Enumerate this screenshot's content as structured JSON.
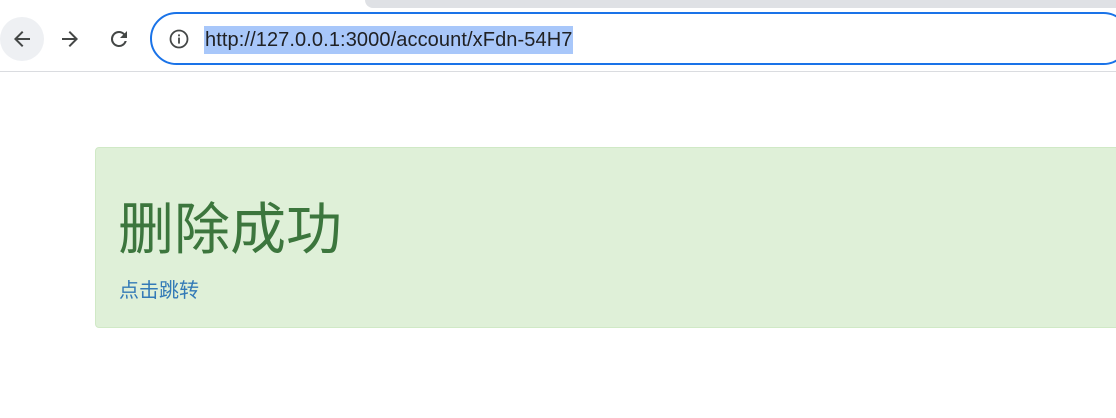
{
  "browser": {
    "nav": {
      "back_icon": "arrow-left-icon",
      "forward_icon": "arrow-right-icon",
      "reload_icon": "reload-icon"
    },
    "omnibox": {
      "site_info_icon": "info-circle-icon",
      "url": "http://127.0.0.1:3000/account/xFdn-54H7",
      "url_selected": true
    },
    "colors": {
      "focus_ring": "#1a73e8",
      "selection": "#a8c7fa"
    }
  },
  "page": {
    "alert": {
      "title": "删除成功",
      "link_label": "点击跳转",
      "colors": {
        "background": "#dff0d8",
        "border": "#d0e9c6",
        "title": "#3c763d",
        "link": "#337ab7"
      }
    }
  }
}
